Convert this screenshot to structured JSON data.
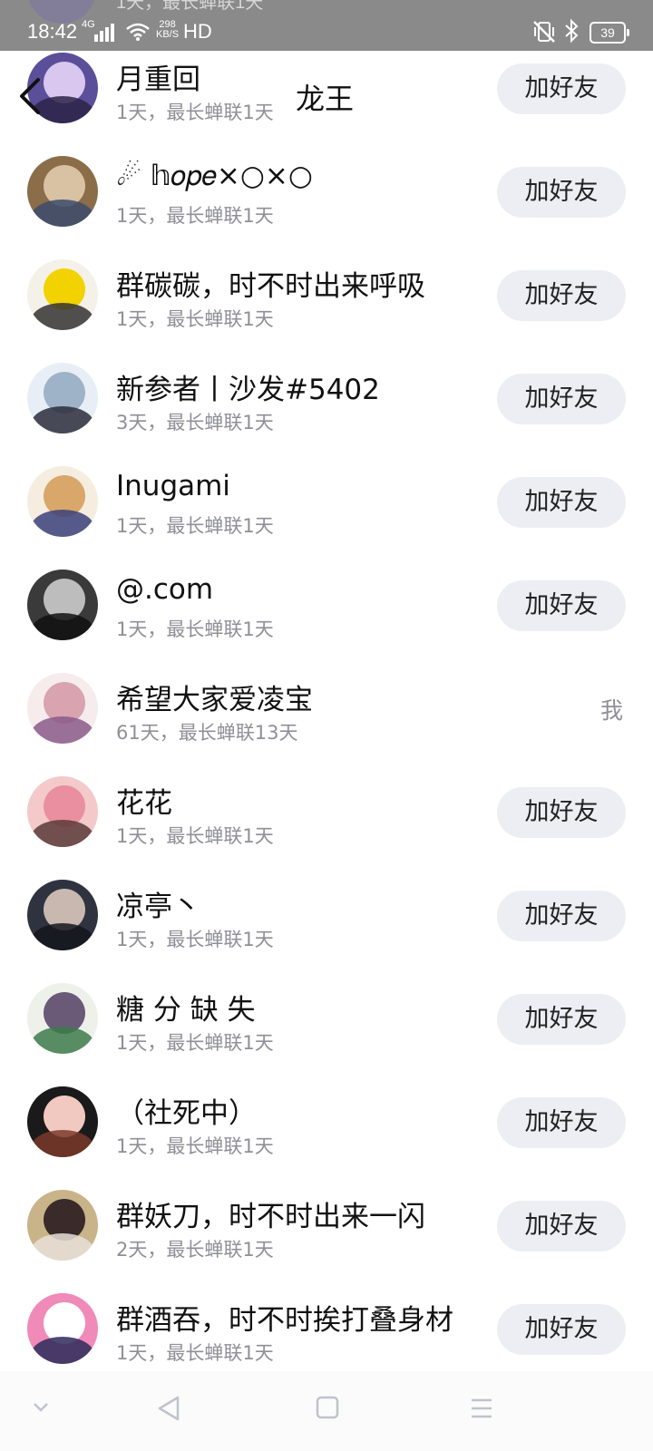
{
  "status_bar": {
    "time": "18:42",
    "network": "4G",
    "speed_value": "298",
    "speed_unit": "KB/S",
    "hd": "HD",
    "battery": "39",
    "partial_top_text": "1天，最长蝉联1天"
  },
  "header": {
    "title": "龙王",
    "back_icon": "chevron-left-icon"
  },
  "add_friend_label": "加好友",
  "members": [
    {
      "name": "月重回",
      "stats": "1天，最长蝉联1天",
      "action": "add",
      "avatar_colors": [
        "#5b4f9a",
        "#d9c7f0",
        "#2b2347"
      ]
    },
    {
      "name": "☄ 𝕙𝑜𝑝𝑒×○×○",
      "stats": "1天，最长蝉联1天",
      "action": "add",
      "avatar_colors": [
        "#8b6d4a",
        "#d8c2a3",
        "#3b4b6b"
      ]
    },
    {
      "name": "群碳碳，时不时出来呼吸",
      "stats": "1天，最长蝉联1天",
      "action": "add",
      "avatar_colors": [
        "#f4f1e8",
        "#f2d200",
        "#333333"
      ]
    },
    {
      "name": "新参者丨沙发#5402",
      "stats": "3天，最长蝉联1天",
      "action": "add",
      "avatar_colors": [
        "#e8eef5",
        "#9fb3c8",
        "#2a2d3a"
      ]
    },
    {
      "name": "Inugami",
      "stats": "1天，最长蝉联1天",
      "action": "add",
      "avatar_colors": [
        "#f5ede0",
        "#d9a76a",
        "#3a3f7a"
      ]
    },
    {
      "name": "@.com",
      "stats": "1天，最长蝉联1天",
      "action": "add",
      "avatar_colors": [
        "#3a3a3a",
        "#bdbdbd",
        "#111111"
      ]
    },
    {
      "name": "希望大家爱凌宝",
      "stats": "61天，最长蝉联13天",
      "action": "me",
      "me_label": "我",
      "avatar_colors": [
        "#f6ecec",
        "#d9a3b0",
        "#8a5a8a"
      ]
    },
    {
      "name": "花花",
      "stats": "1天，最长蝉联1天",
      "action": "add",
      "avatar_colors": [
        "#f3c9c9",
        "#e98fa0",
        "#5a3a3a"
      ]
    },
    {
      "name": "凉亭丶",
      "stats": "1天，最长蝉联1天",
      "action": "add",
      "avatar_colors": [
        "#2f3340",
        "#c9b8b0",
        "#14161d"
      ]
    },
    {
      "name": "糖 分 缺 失",
      "stats": "1天，最长蝉联1天",
      "action": "add",
      "avatar_colors": [
        "#eef0ea",
        "#6a5a78",
        "#3d7a4a"
      ]
    },
    {
      "name": "（社死中）",
      "stats": "1天，最长蝉联1天",
      "action": "add",
      "avatar_colors": [
        "#1a1a1a",
        "#f2c9c0",
        "#7a3a2a"
      ]
    },
    {
      "name": "群妖刀，时不时出来一闪",
      "stats": "2天，最长蝉联1天",
      "action": "add",
      "avatar_colors": [
        "#c9b48a",
        "#3a2a2a",
        "#e8e0d8"
      ]
    },
    {
      "name": "群酒吞，时不时挨打叠身材",
      "stats": "1天，最长蝉联1天",
      "action": "add",
      "avatar_colors": [
        "#f08ab8",
        "#ffffff",
        "#2a2a5a"
      ]
    }
  ],
  "nav_bar": {
    "items": [
      "chevron-down-icon",
      "back-triangle-icon",
      "home-square-icon",
      "menu-lines-icon"
    ]
  }
}
